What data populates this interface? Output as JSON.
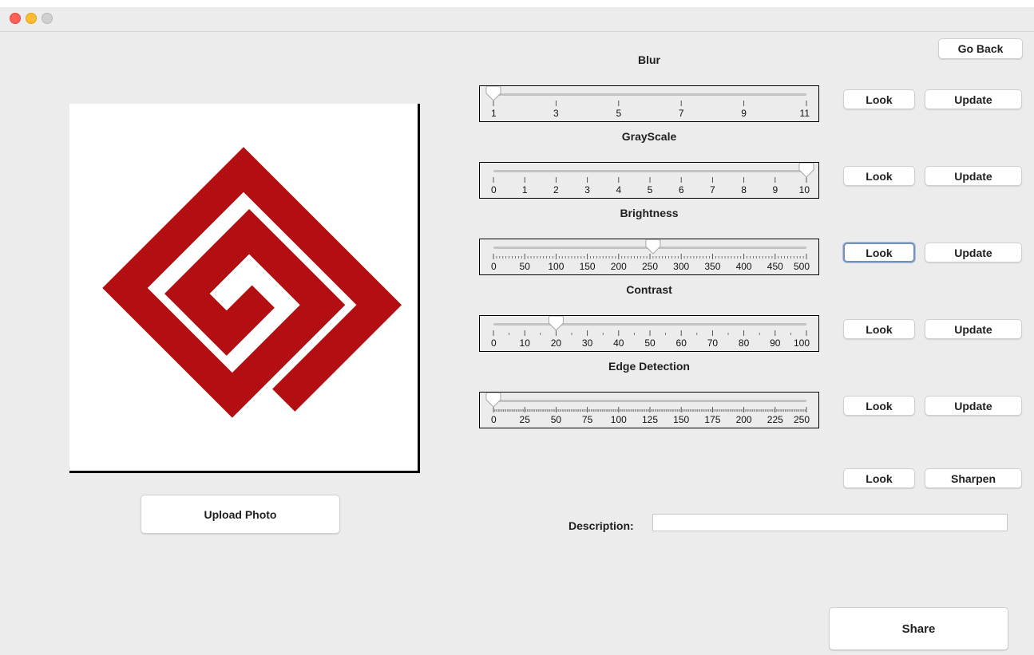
{
  "window": {
    "title": "",
    "traffic_lights": [
      "close",
      "minimize",
      "zoom"
    ]
  },
  "go_back_label": "Go Back",
  "upload_label": "Upload Photo",
  "share_label": "Share",
  "description": {
    "label": "Description:",
    "value": ""
  },
  "preview": {
    "logo_color": "#b30f12"
  },
  "sliders": [
    {
      "label": "Blur",
      "min": 1,
      "max": 11,
      "value": 1,
      "major_ticks": [
        "1",
        "3",
        "5",
        "7",
        "9",
        "11"
      ],
      "minor_ticks_per_major": 0,
      "look_label": "Look",
      "update_label": "Update"
    },
    {
      "label": "GrayScale",
      "min": 0,
      "max": 10,
      "value": 10,
      "major_ticks": [
        "0",
        "1",
        "2",
        "3",
        "4",
        "5",
        "6",
        "7",
        "8",
        "9",
        "10"
      ],
      "minor_ticks_per_major": 0,
      "look_label": "Look",
      "update_label": "Update"
    },
    {
      "label": "Brightness",
      "min": 0,
      "max": 500,
      "value": 255,
      "major_ticks": [
        "0",
        "50",
        "100",
        "150",
        "200",
        "250",
        "300",
        "350",
        "400",
        "450",
        "500"
      ],
      "minor_ticks_per_major": 10,
      "look_label": "Look",
      "update_label": "Update"
    },
    {
      "label": "Contrast",
      "min": 0,
      "max": 100,
      "value": 20,
      "major_ticks": [
        "0",
        "10",
        "20",
        "30",
        "40",
        "50",
        "60",
        "70",
        "80",
        "90",
        "100"
      ],
      "minor_ticks_per_major": 2,
      "look_label": "Look",
      "update_label": "Update"
    },
    {
      "label": "Edge Detection",
      "min": 0,
      "max": 250,
      "value": 0,
      "major_ticks": [
        "0",
        "25",
        "50",
        "75",
        "100",
        "125",
        "150",
        "175",
        "200",
        "225",
        "250"
      ],
      "minor_ticks_per_major": 25,
      "look_label": "Look",
      "update_label": "Update"
    }
  ],
  "sharpen_row": {
    "look_label": "Look",
    "sharpen_label": "Sharpen"
  }
}
